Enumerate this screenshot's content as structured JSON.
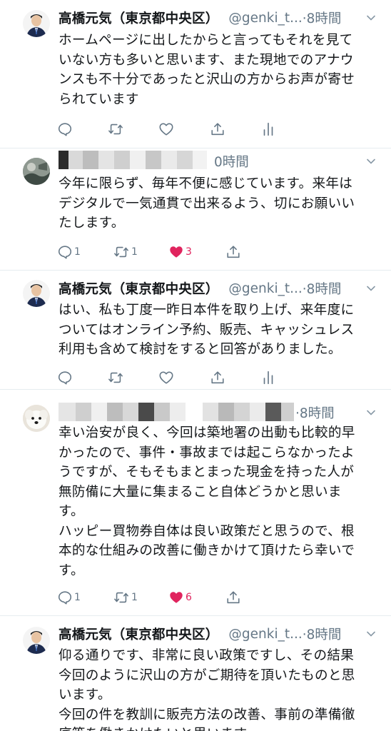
{
  "tweets": [
    {
      "author_name": "高橋元気（東京都中央区）",
      "handle": "@genki_t...",
      "time": "·8時間",
      "lines": [
        "ホームページに出したからと言ってもそれを見て",
        "いない方も多いと思います、また現地でのアナウ",
        "ンスも不十分であったと沢山の方からお声が寄せ",
        "られています"
      ],
      "actions": {
        "reply": "",
        "retweet": "",
        "like": ""
      }
    },
    {
      "author_name": "",
      "handle": "",
      "time": "0時間",
      "lines": [
        "今年に限らず、毎年不便に感じています。来年は",
        "デジタルで一気通貫で出来るよう、切にお願いい",
        "たします。"
      ],
      "actions": {
        "reply": "1",
        "retweet": "1",
        "like": "3"
      }
    },
    {
      "author_name": "高橋元気（東京都中央区）",
      "handle": "@genki_t...",
      "time": "·8時間",
      "lines": [
        "はい、私も丁度一昨日本件を取り上げ、来年度に",
        "ついてはオンライン予約、販売、キャッシュレス",
        "利用も含めて検討をすると回答がありました。"
      ],
      "actions": {
        "reply": "",
        "retweet": "",
        "like": ""
      }
    },
    {
      "author_name": "",
      "handle": "",
      "time": "·8時間",
      "lines": [
        "幸い治安が良く、今回は築地署の出動も比較的早",
        "かったので、事件・事故までは起こらなかったよ",
        "うですが、そもそもまとまった現金を持った人が",
        "無防備に大量に集まること自体どうかと思いま",
        "す。",
        "ハッピー買物券自体は良い政策だと思うので、根",
        "本的な仕組みの改善に働きかけて頂けたら幸いで",
        "す。"
      ],
      "actions": {
        "reply": "1",
        "retweet": "1",
        "like": "6"
      }
    },
    {
      "author_name": "高橋元気（東京都中央区）",
      "handle": "@genki_t...",
      "time": "·8時間",
      "lines": [
        "仰る通りです、非常に良い政策ですし、その結果",
        "今回のように沢山の方がご期待を頂いたものと思",
        "います。",
        "今回の件を教訓に販売方法の改善、事前の準備徹",
        "底等を働きかけたいと思います。"
      ]
    }
  ],
  "colors": {
    "text": "#14171a",
    "muted": "#657786",
    "like": "#e0245e",
    "divider": "#e6ecf0"
  },
  "icons": [
    "reply-icon",
    "retweet-icon",
    "like-icon",
    "share-icon",
    "analytics-icon",
    "chevron-down-icon"
  ]
}
